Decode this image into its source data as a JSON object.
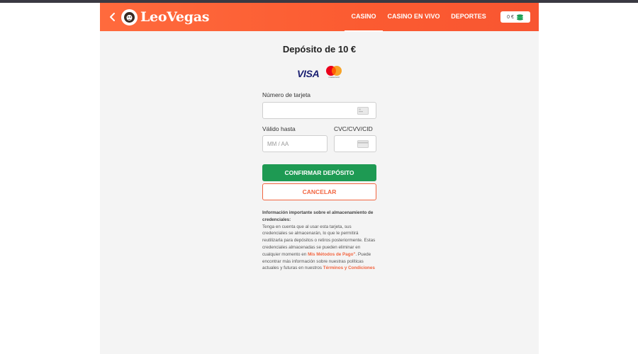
{
  "header": {
    "brand": "LeoVegas",
    "nav": [
      "CASINO",
      "CASINO EN VIVO",
      "DEPORTES"
    ],
    "active_nav": "CASINO",
    "balance": "0 €"
  },
  "deposit": {
    "title": "Depósito de 10 €",
    "card_brands": {
      "visa": "VISA",
      "mastercard": "mastercard"
    },
    "card_number_label": "Número de tarjeta",
    "card_number_value": "",
    "expiry_label": "Válido hasta",
    "expiry_placeholder": "MM / AA",
    "cvc_label": "CVC/CVV/CID",
    "cvc_value": "",
    "confirm_label": "CONFIRMAR DEPÓSITO",
    "cancel_label": "CANCELAR"
  },
  "info": {
    "title": "Información importante sobre el almacenamiento de credenciales:",
    "text_before_link1": "Tenga en cuenta que al usar esta tarjeta, sus credenciales se almacenarán, lo que le permitirá reutilizarla para depósitos o retiros posteriormente. Estas credenciales almacenadas se pueden eliminar en cualquier momento en",
    "link1": " Mis Métodos de Pago\"",
    "text_between": ". Puede encontrar más información sobre nuestras políticas actuales y futuras en nuestros",
    "link2": "Términos y Condiciones"
  },
  "colors": {
    "header_orange": "#fb5b31",
    "confirm_green": "#1e9a53",
    "cancel_orange": "#f26540",
    "visa_blue": "#1a1f71"
  }
}
